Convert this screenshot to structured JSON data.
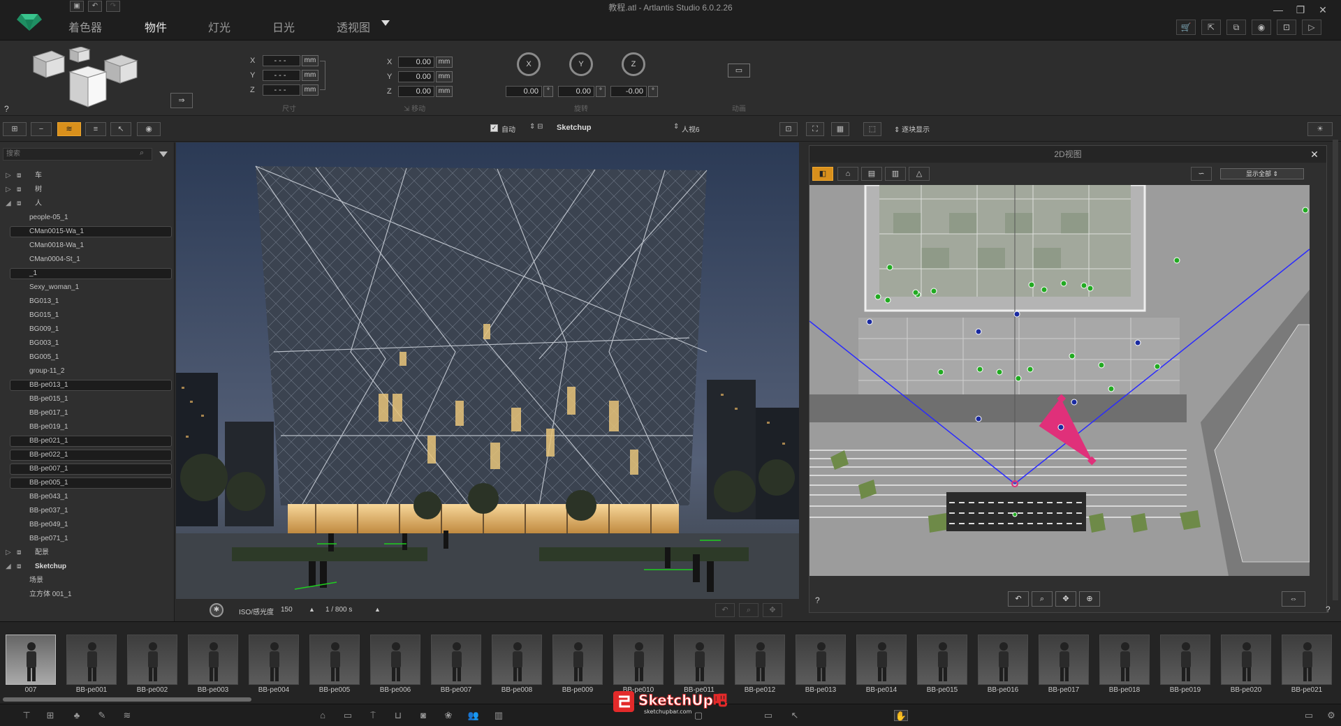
{
  "window": {
    "title": "教程.atl - Artlantis Studio 6.0.2.26"
  },
  "menu": {
    "tabs": [
      {
        "label": "着色器"
      },
      {
        "label": "物件"
      },
      {
        "label": "灯光"
      },
      {
        "label": "日光"
      },
      {
        "label": "透视图"
      }
    ],
    "active_index": 1
  },
  "size_group": {
    "label": "尺寸",
    "x": "- - -",
    "y": "- - -",
    "z": "- - -",
    "unit": "mm"
  },
  "move_group": {
    "label": "移动",
    "x": "0.00",
    "y": "0.00",
    "z": "0.00",
    "unit": "mm"
  },
  "rotate_group": {
    "label": "旋转",
    "x_label": "X",
    "y_label": "Y",
    "z_label": "Z",
    "x": "0.00",
    "y": "0.00",
    "z": "-0.00",
    "unit": "°"
  },
  "anim_group": {
    "label": "动画"
  },
  "help_mark": "?",
  "subbar": {
    "auto_label": "自动",
    "auto_checked": true,
    "source_label": "Sketchup",
    "layer_label": "人视6",
    "display_label": "逐块显示"
  },
  "search": {
    "placeholder": "搜索"
  },
  "tree": [
    {
      "label": "车",
      "kind": "group",
      "expanded": false
    },
    {
      "label": "树",
      "kind": "group",
      "expanded": false
    },
    {
      "label": "人",
      "kind": "group",
      "expanded": true
    },
    {
      "label": "people-05_1",
      "kind": "item",
      "selected": false
    },
    {
      "label": "CMan0015-Wa_1",
      "kind": "item",
      "selected": true
    },
    {
      "label": "CMan0018-Wa_1",
      "kind": "item",
      "selected": false
    },
    {
      "label": "CMan0004-St_1",
      "kind": "item",
      "selected": false
    },
    {
      "label": "_1",
      "kind": "item",
      "selected": true
    },
    {
      "label": "Sexy_woman_1",
      "kind": "item",
      "selected": false
    },
    {
      "label": "BG013_1",
      "kind": "item",
      "selected": false
    },
    {
      "label": "BG015_1",
      "kind": "item",
      "selected": false
    },
    {
      "label": "BG009_1",
      "kind": "item",
      "selected": false
    },
    {
      "label": "BG003_1",
      "kind": "item",
      "selected": false
    },
    {
      "label": "BG005_1",
      "kind": "item",
      "selected": false
    },
    {
      "label": "group-11_2",
      "kind": "item",
      "selected": false
    },
    {
      "label": "BB-pe013_1",
      "kind": "item",
      "selected": true
    },
    {
      "label": "BB-pe015_1",
      "kind": "item",
      "selected": false
    },
    {
      "label": "BB-pe017_1",
      "kind": "item",
      "selected": false
    },
    {
      "label": "BB-pe019_1",
      "kind": "item",
      "selected": false
    },
    {
      "label": "BB-pe021_1",
      "kind": "item",
      "selected": true
    },
    {
      "label": "BB-pe022_1",
      "kind": "item",
      "selected": true
    },
    {
      "label": "BB-pe007_1",
      "kind": "item",
      "selected": true
    },
    {
      "label": "BB-pe005_1",
      "kind": "item",
      "selected": true
    },
    {
      "label": "BB-pe043_1",
      "kind": "item",
      "selected": false
    },
    {
      "label": "BB-pe037_1",
      "kind": "item",
      "selected": false
    },
    {
      "label": "BB-pe049_1",
      "kind": "item",
      "selected": false
    },
    {
      "label": "BB-pe071_1",
      "kind": "item",
      "selected": false
    },
    {
      "label": "配景",
      "kind": "group",
      "expanded": false
    },
    {
      "label": "Sketchup",
      "kind": "group",
      "expanded": true
    },
    {
      "label": "场景",
      "kind": "item",
      "selected": false
    },
    {
      "label": "立方体 001_1",
      "kind": "item",
      "selected": false
    }
  ],
  "view2d": {
    "title": "2D视图",
    "display_select": "显示全部",
    "help": "?"
  },
  "render_status": {
    "iso_label": "ISO/感光度",
    "iso_value": "150",
    "shutter": "1 / 800 s"
  },
  "library": [
    {
      "label": "007",
      "selected": true
    },
    {
      "label": "BB-pe001"
    },
    {
      "label": "BB-pe002"
    },
    {
      "label": "BB-pe003"
    },
    {
      "label": "BB-pe004"
    },
    {
      "label": "BB-pe005"
    },
    {
      "label": "BB-pe006"
    },
    {
      "label": "BB-pe007"
    },
    {
      "label": "BB-pe008"
    },
    {
      "label": "BB-pe009"
    },
    {
      "label": "BB-pe010"
    },
    {
      "label": "BB-pe011"
    },
    {
      "label": "BB-pe012"
    },
    {
      "label": "BB-pe013"
    },
    {
      "label": "BB-pe014"
    },
    {
      "label": "BB-pe015"
    },
    {
      "label": "BB-pe016"
    },
    {
      "label": "BB-pe017"
    },
    {
      "label": "BB-pe018"
    },
    {
      "label": "BB-pe019"
    },
    {
      "label": "BB-pe020"
    },
    {
      "label": "BB-pe021"
    }
  ],
  "watermark": {
    "text": "SketchUp吧",
    "sub": "sketchupbar.com"
  },
  "colors": {
    "accent": "#d9901c",
    "plan_blue": "#2a2aff",
    "plan_pink": "#e0307a",
    "dot_green": "#22aa22",
    "dot_blue": "#1a2aa0"
  }
}
